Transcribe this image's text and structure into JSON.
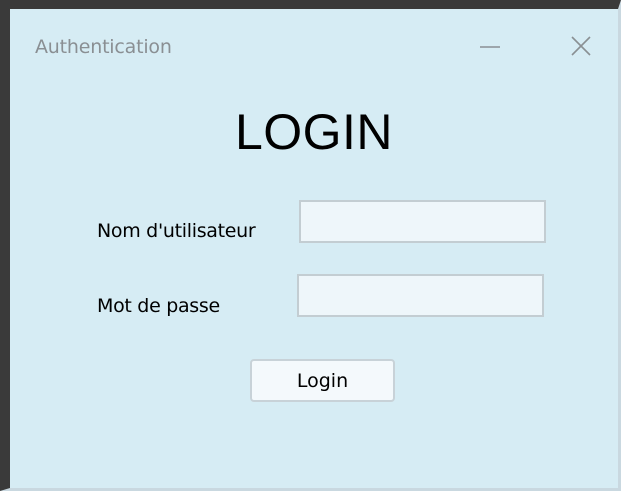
{
  "window": {
    "title": "Authentication",
    "minimize_icon": "minimize-icon",
    "close_icon": "close-icon"
  },
  "form": {
    "heading": "LOGIN",
    "username_label": "Nom d'utilisateur",
    "username_value": "",
    "password_label": "Mot de passe",
    "password_value": "",
    "submit_label": "Login"
  },
  "colors": {
    "background": "#d6ecf4",
    "input_background": "#eef6fa",
    "title_text": "#8a8f93"
  }
}
